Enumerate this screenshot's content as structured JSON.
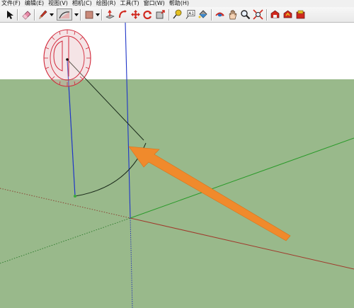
{
  "menu": [
    {
      "label": "文件(F)"
    },
    {
      "label": "编辑(E)"
    },
    {
      "label": "视图(V)"
    },
    {
      "label": "相机(C)"
    },
    {
      "label": "绘图(R)"
    },
    {
      "label": "工具(T)"
    },
    {
      "label": "窗口(W)"
    },
    {
      "label": "帮助(H)"
    }
  ],
  "toolbar": {
    "tools": [
      {
        "name": "select-tool-icon"
      },
      {
        "name": "eraser-tool-icon"
      },
      {
        "name": "pencil-line-tool-icon"
      },
      {
        "name": "arc-tool-icon"
      },
      {
        "name": "rectangle-tool-icon"
      },
      {
        "name": "push-pull-tool-icon"
      },
      {
        "name": "follow-me-tool-icon"
      },
      {
        "name": "move-tool-icon"
      },
      {
        "name": "rotate-tool-icon"
      },
      {
        "name": "scale-tool-icon"
      },
      {
        "name": "tape-measure-tool-icon"
      },
      {
        "name": "text-tool-icon"
      },
      {
        "name": "paint-bucket-tool-icon"
      },
      {
        "name": "orbit-tool-icon"
      },
      {
        "name": "pan-tool-icon"
      },
      {
        "name": "zoom-tool-icon"
      },
      {
        "name": "zoom-extents-tool-icon"
      },
      {
        "name": "warehouse-icon"
      },
      {
        "name": "share-model-icon"
      },
      {
        "name": "extension-warehouse-icon"
      }
    ],
    "text_tool_glyph": "A1"
  },
  "colors": {
    "ground": "#99b98b",
    "sky": "#ffffff",
    "axis_blue": "#1f35c8",
    "axis_red": "#a03a2c",
    "axis_green": "#2a9a2a",
    "protractor": "#d2283a",
    "arrow": "#f08a2c",
    "arc": "#1b2b1b"
  }
}
